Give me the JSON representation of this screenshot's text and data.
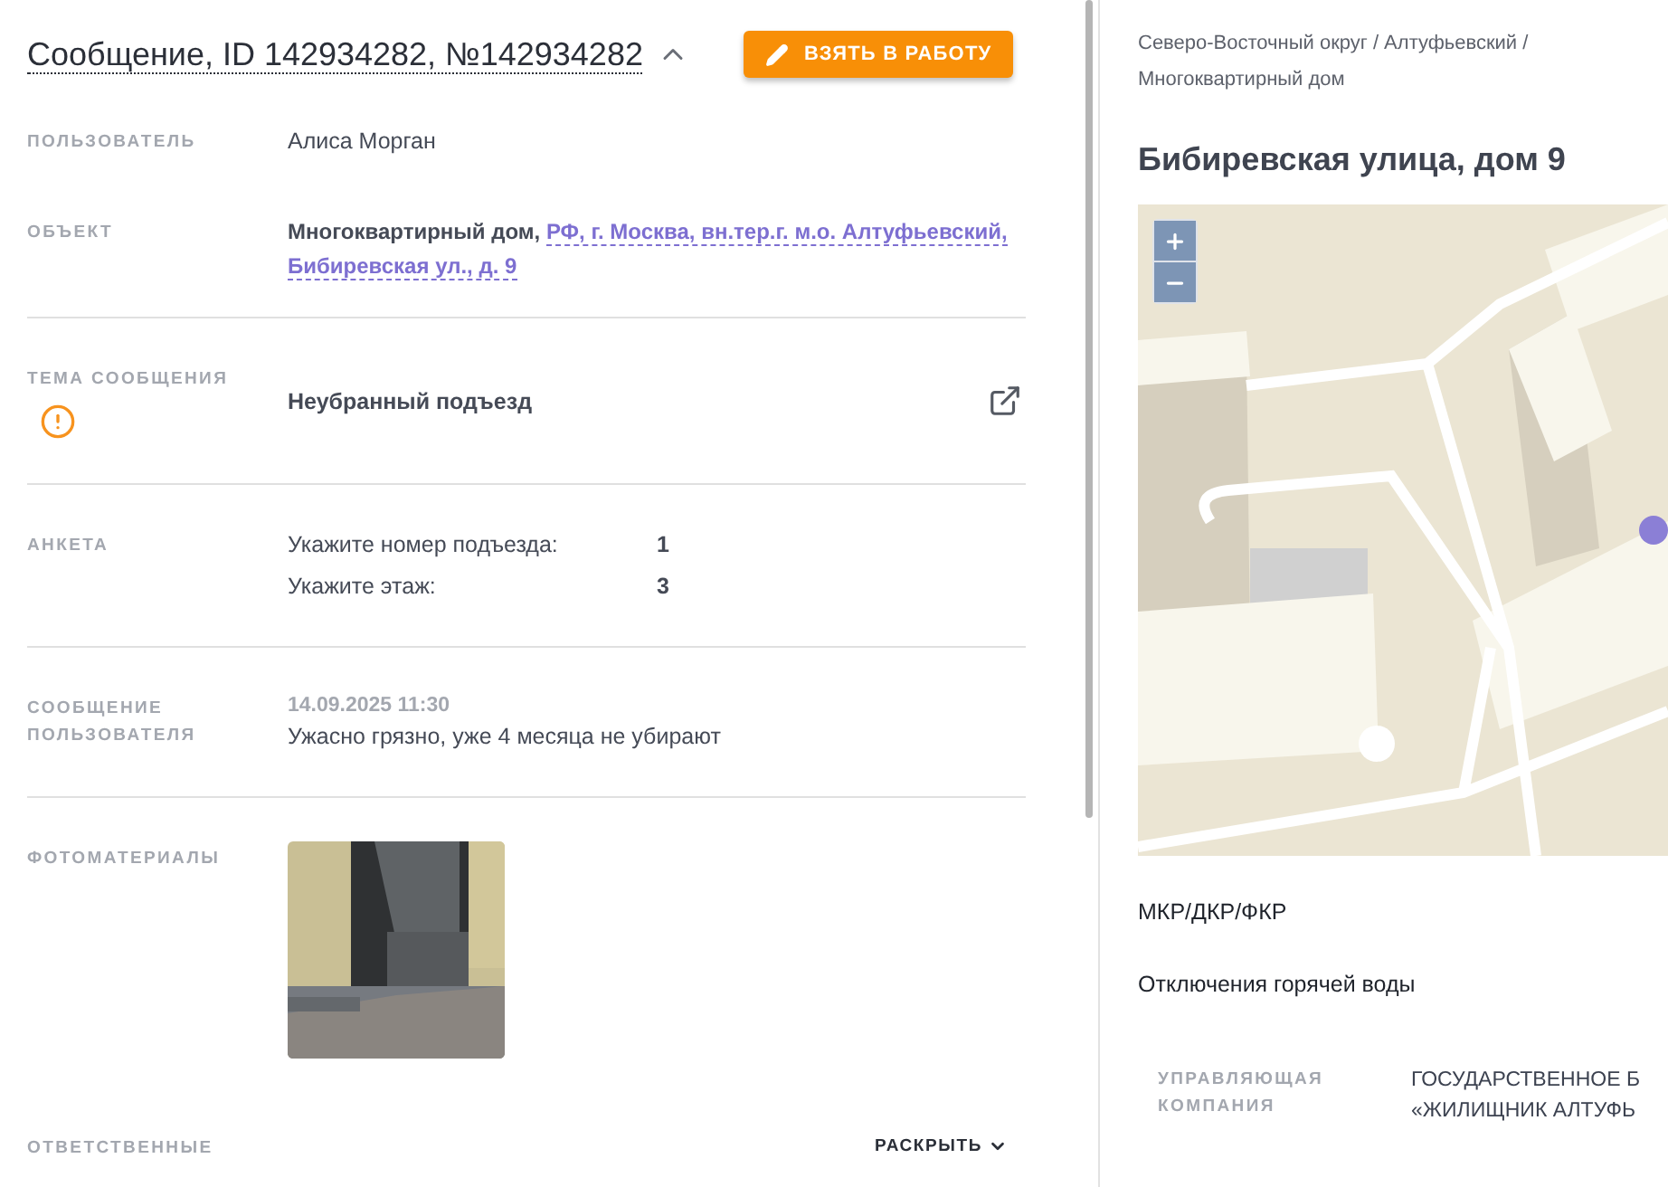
{
  "header": {
    "title": "Сообщение, ID 142934282, №142934282",
    "expanded": true,
    "action_button": "ВЗЯТЬ В РАБОТУ"
  },
  "fields": [
    {
      "kind": "text",
      "label": "ПОЛЬЗОВАТЕЛЬ",
      "value": "Алиса Морган",
      "divider": false
    },
    {
      "kind": "object",
      "label": "ОБЪЕКТ",
      "object_type": "Многоквартирный дом,",
      "address_lines": [
        "РФ, г. Москва, вн.тер.г. м.о. Алтуфьевский,",
        "Бибиревская ул., д. 9"
      ],
      "divider": true
    },
    {
      "kind": "topic",
      "label": "ТЕМА СООБЩЕНИЯ",
      "value": "Неубранный подъезд",
      "warning": true,
      "divider": true
    },
    {
      "kind": "survey",
      "label": "АНКЕТА",
      "answers": [
        {
          "question": "Укажите номер подъезда:",
          "answer": "1"
        },
        {
          "question": "Укажите этаж:",
          "answer": "3"
        }
      ],
      "divider": true
    },
    {
      "kind": "message",
      "label": "СООБЩЕНИЕ ПОЛЬЗОВАТЕЛЯ",
      "date": "14.09.2025 11:30",
      "text": "Ужасно грязно, уже 4 месяца не убирают",
      "divider": true
    },
    {
      "kind": "photos",
      "label": "ФОТОМАТЕРИАЛЫ",
      "divider": false
    },
    {
      "kind": "collapsible",
      "label": "ОТВЕТСТВЕННЫЕ",
      "toggle": "РАСКРЫТЬ",
      "expanded": false,
      "divider": false
    }
  ],
  "right": {
    "breadcrumb": "Северо-Восточный округ / Алтуфьевский / Многоквартирный дом",
    "title": "Бибиревская улица, дом 9",
    "sections": [
      "МКР/ДКР/ФКР",
      "Отключения горячей воды"
    ],
    "details": [
      {
        "label": "УПРАВЛЯЮЩАЯ КОМПАНИЯ",
        "value_lines": [
          "ГОСУДАРСТВЕННОЕ Б",
          "«ЖИЛИЩНИК АЛТУФЬ"
        ]
      }
    ]
  }
}
